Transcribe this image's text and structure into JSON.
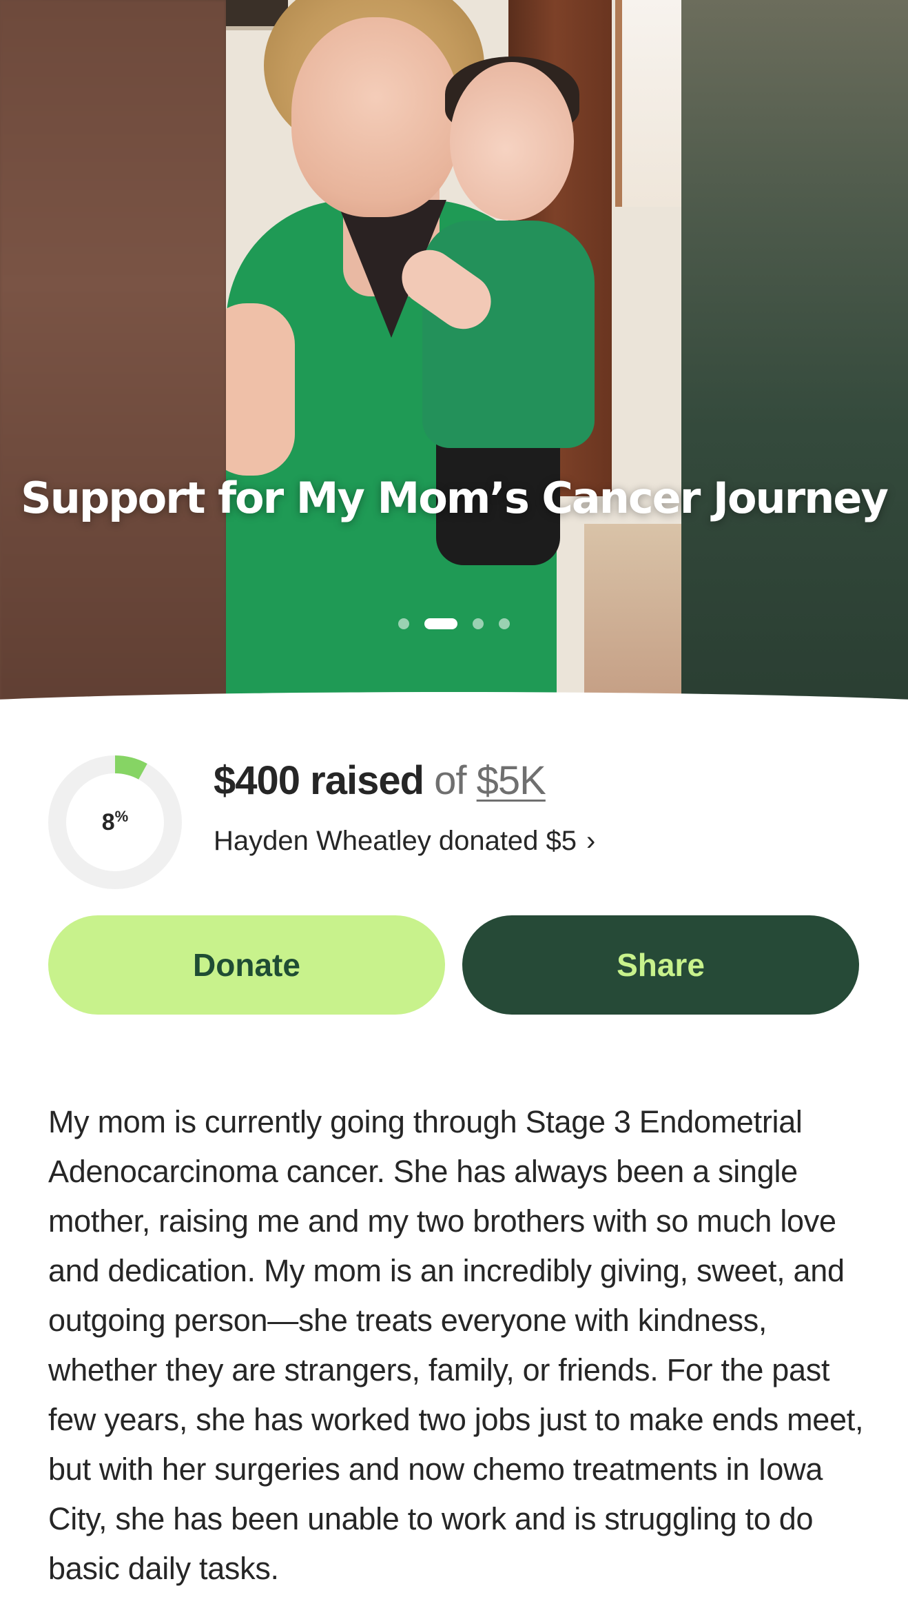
{
  "campaign": {
    "title": "Support for My Mom’s Cancer Journey",
    "carousel": {
      "slide_count": 4,
      "active_index": 1
    }
  },
  "progress": {
    "percent": 8,
    "percent_label": "8",
    "percent_unit": "%",
    "raised_amount": "$400 raised",
    "of_text": " of ",
    "goal": "$5K"
  },
  "recent_donation": {
    "text": "Hayden Wheatley donated $5",
    "chevron": "›"
  },
  "actions": {
    "donate_label": "Donate",
    "share_label": "Share"
  },
  "story": {
    "text": "My mom is currently going through Stage 3 Endometrial Adenocarcinoma cancer. She has always been a single mother, raising me and my two brothers with so much love and dedication. My mom is an incredibly giving, sweet, and outgoing person—she treats everyone with kindness, whether they are strangers, family, or friends. For the past few years, she has worked two jobs just to make ends meet, but with her surgeries and now chemo treatments in Iowa City, she has been unable to work and is struggling to do basic daily tasks."
  },
  "colors": {
    "accent_green": "#c8f28c",
    "dark_green": "#264a37",
    "progress_fill": "#86d464",
    "progress_track": "#f0f0f0"
  }
}
